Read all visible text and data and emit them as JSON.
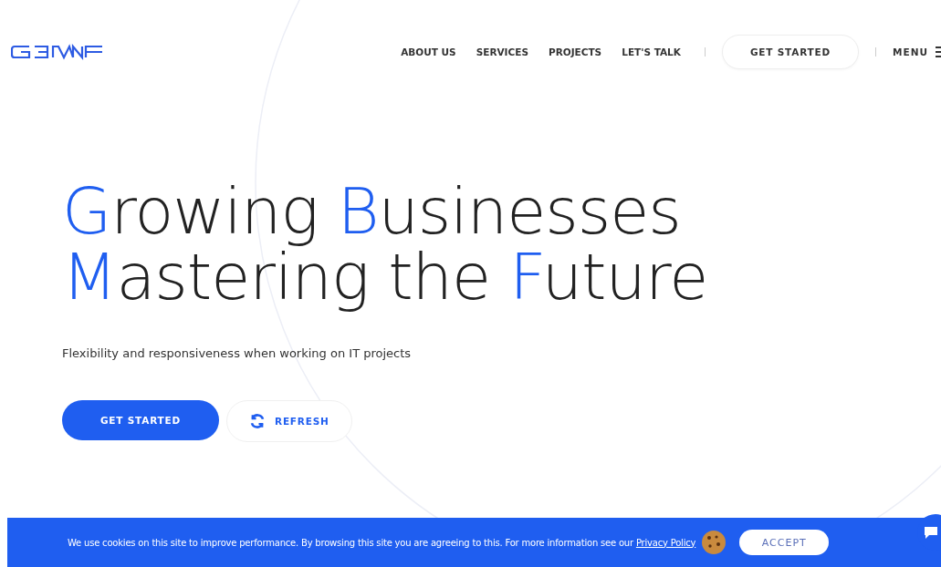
{
  "nav": {
    "links": [
      "ABOUT US",
      "SERVICES",
      "PROJECTS",
      "LET'S TALK"
    ],
    "cta": "GET STARTED",
    "menu": "MENU"
  },
  "hero": {
    "headline": [
      [
        {
          "accent": "G",
          "text": "rowing"
        },
        {
          "accent": "B",
          "text": "usinesses"
        }
      ],
      [
        {
          "accent": "M",
          "text": "astering"
        },
        {
          "text": "the"
        },
        {
          "accent": "F",
          "text": "uture"
        }
      ]
    ],
    "subtitle": "Flexibility and responsiveness when working on IT projects",
    "primary_button": "GET STARTED",
    "secondary_button": "REFRESH"
  },
  "cookie_bar": {
    "text": "We use cookies on this site to improve performance. By browsing this site you are agreeing to this. For more information see our",
    "link": "Privacy Policy",
    "button": "ACCEPT"
  }
}
